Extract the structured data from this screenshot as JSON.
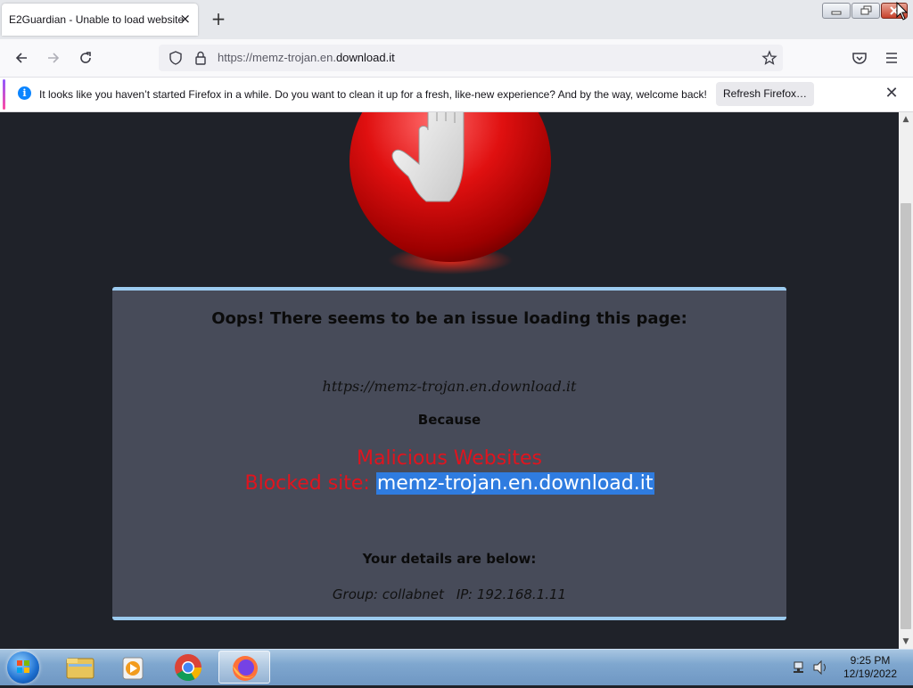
{
  "browser": {
    "tab": {
      "title": "E2Guardian - Unable to load website",
      "close_glyph": "×"
    },
    "new_tab_glyph": "+",
    "url": {
      "prefix": "https://memz-trojan.en.",
      "domain": "download.it"
    },
    "notification": {
      "text": "It looks like you haven’t started Firefox in a while. Do you want to clean it up for a fresh, like-new experience? And by the way, welcome back!",
      "button": "Refresh Firefox…",
      "close_glyph": "✕"
    }
  },
  "page": {
    "heading": "Oops! There seems to be an issue loading this page:",
    "blocked_url": "https://memz-trojan.en.download.it",
    "because": "Because",
    "reason": "Malicious Websites",
    "blocked_prefix": "Blocked site: ",
    "blocked_site": "memz-trojan.en.download.it",
    "details_heading": "Your details are below:",
    "group": "Group: collabnet",
    "ip": "IP: 192.168.1.11"
  },
  "taskbar": {
    "items": [
      "windows-explorer",
      "media-player",
      "google-chrome",
      "firefox"
    ],
    "time": "9:25 PM",
    "date": "12/19/2022"
  },
  "colors": {
    "page_bg": "#1f2229",
    "panel_bg": "#474b59",
    "panel_border": "#9ccbef",
    "alert_red": "#e0141e",
    "selection_blue": "#2f7ce0"
  }
}
